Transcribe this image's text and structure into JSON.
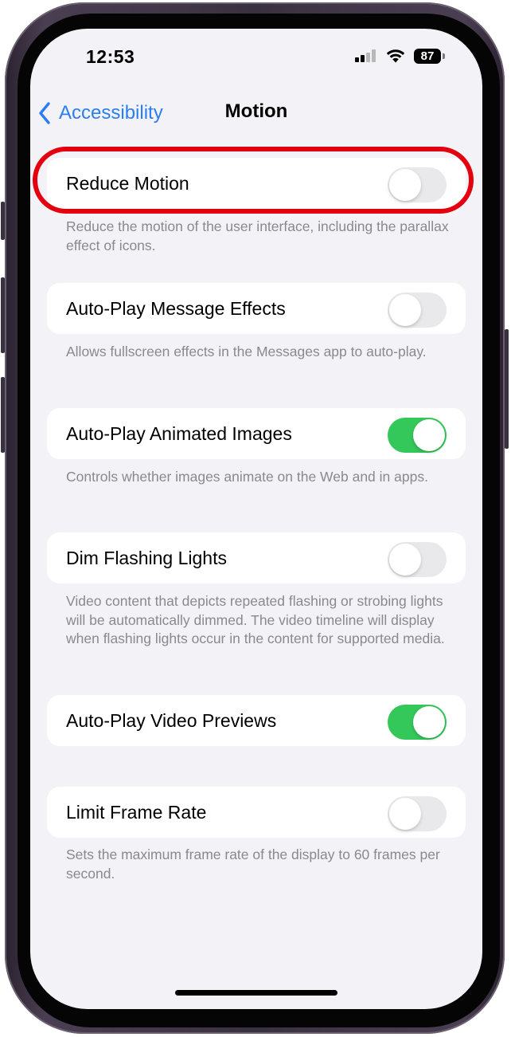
{
  "status_bar": {
    "time": "12:53",
    "battery": "87"
  },
  "nav": {
    "back_label": "Accessibility",
    "title": "Motion"
  },
  "settings": [
    {
      "label": "Reduce Motion",
      "on": false,
      "footer": "Reduce the motion of the user interface, including the parallax effect of icons."
    },
    {
      "label": "Auto-Play Message Effects",
      "on": false,
      "footer": "Allows fullscreen effects in the Messages app to auto-play."
    },
    {
      "label": "Auto-Play Animated Images",
      "on": true,
      "footer": "Controls whether images animate on the Web and in apps."
    },
    {
      "label": "Dim Flashing Lights",
      "on": false,
      "footer": "Video content that depicts repeated flashing or strobing lights will be automatically dimmed. The video timeline will display when flashing lights occur in the content for supported media."
    },
    {
      "label": "Auto-Play Video Previews",
      "on": true,
      "footer": ""
    },
    {
      "label": "Limit Frame Rate",
      "on": false,
      "footer": "Sets the maximum frame rate of the display to 60 frames per second."
    }
  ],
  "colors": {
    "accent": "#2c7ef0",
    "toggle_on": "#34c759",
    "toggle_off": "#e9e9eb",
    "highlight": "#e3000f",
    "background": "#f2f2f7"
  }
}
